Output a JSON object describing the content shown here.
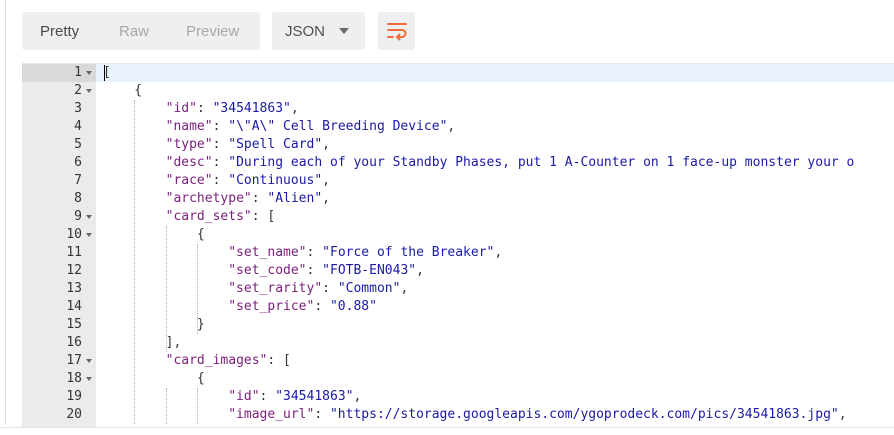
{
  "toolbar": {
    "pretty_label": "Pretty",
    "raw_label": "Raw",
    "preview_label": "Preview",
    "format_label": "JSON",
    "active_tab": "Pretty",
    "wrap_icon": "wrap-lines-icon",
    "accent_color": "#f26b3a"
  },
  "editor": {
    "lines": [
      {
        "n": "1",
        "fold": true,
        "tokens": [
          [
            "p",
            "["
          ]
        ]
      },
      {
        "n": "2",
        "fold": true,
        "tokens": [
          [
            "p",
            "    {"
          ]
        ]
      },
      {
        "n": "3",
        "fold": false,
        "tokens": [
          [
            "p",
            "        "
          ],
          [
            "k",
            "\"id\""
          ],
          [
            "p",
            ": "
          ],
          [
            "s",
            "\"34541863\""
          ],
          [
            "p",
            ","
          ]
        ]
      },
      {
        "n": "4",
        "fold": false,
        "tokens": [
          [
            "p",
            "        "
          ],
          [
            "k",
            "\"name\""
          ],
          [
            "p",
            ": "
          ],
          [
            "s",
            "\"\\\"A\\\" Cell Breeding Device\""
          ],
          [
            "p",
            ","
          ]
        ]
      },
      {
        "n": "5",
        "fold": false,
        "tokens": [
          [
            "p",
            "        "
          ],
          [
            "k",
            "\"type\""
          ],
          [
            "p",
            ": "
          ],
          [
            "s",
            "\"Spell Card\""
          ],
          [
            "p",
            ","
          ]
        ]
      },
      {
        "n": "6",
        "fold": false,
        "tokens": [
          [
            "p",
            "        "
          ],
          [
            "k",
            "\"desc\""
          ],
          [
            "p",
            ": "
          ],
          [
            "s",
            "\"During each of your Standby Phases, put 1 A-Counter on 1 face-up monster your o"
          ]
        ]
      },
      {
        "n": "7",
        "fold": false,
        "tokens": [
          [
            "p",
            "        "
          ],
          [
            "k",
            "\"race\""
          ],
          [
            "p",
            ": "
          ],
          [
            "s",
            "\"Continuous\""
          ],
          [
            "p",
            ","
          ]
        ]
      },
      {
        "n": "8",
        "fold": false,
        "tokens": [
          [
            "p",
            "        "
          ],
          [
            "k",
            "\"archetype\""
          ],
          [
            "p",
            ": "
          ],
          [
            "s",
            "\"Alien\""
          ],
          [
            "p",
            ","
          ]
        ]
      },
      {
        "n": "9",
        "fold": true,
        "tokens": [
          [
            "p",
            "        "
          ],
          [
            "k",
            "\"card_sets\""
          ],
          [
            "p",
            ": ["
          ]
        ]
      },
      {
        "n": "10",
        "fold": true,
        "tokens": [
          [
            "p",
            "            {"
          ]
        ]
      },
      {
        "n": "11",
        "fold": false,
        "tokens": [
          [
            "p",
            "                "
          ],
          [
            "k",
            "\"set_name\""
          ],
          [
            "p",
            ": "
          ],
          [
            "s",
            "\"Force of the Breaker\""
          ],
          [
            "p",
            ","
          ]
        ]
      },
      {
        "n": "12",
        "fold": false,
        "tokens": [
          [
            "p",
            "                "
          ],
          [
            "k",
            "\"set_code\""
          ],
          [
            "p",
            ": "
          ],
          [
            "s",
            "\"FOTB-EN043\""
          ],
          [
            "p",
            ","
          ]
        ]
      },
      {
        "n": "13",
        "fold": false,
        "tokens": [
          [
            "p",
            "                "
          ],
          [
            "k",
            "\"set_rarity\""
          ],
          [
            "p",
            ": "
          ],
          [
            "s",
            "\"Common\""
          ],
          [
            "p",
            ","
          ]
        ]
      },
      {
        "n": "14",
        "fold": false,
        "tokens": [
          [
            "p",
            "                "
          ],
          [
            "k",
            "\"set_price\""
          ],
          [
            "p",
            ": "
          ],
          [
            "s",
            "\"0.88\""
          ]
        ]
      },
      {
        "n": "15",
        "fold": false,
        "tokens": [
          [
            "p",
            "            }"
          ]
        ]
      },
      {
        "n": "16",
        "fold": false,
        "tokens": [
          [
            "p",
            "        ],"
          ]
        ]
      },
      {
        "n": "17",
        "fold": true,
        "tokens": [
          [
            "p",
            "        "
          ],
          [
            "k",
            "\"card_images\""
          ],
          [
            "p",
            ": ["
          ]
        ]
      },
      {
        "n": "18",
        "fold": true,
        "tokens": [
          [
            "p",
            "            {"
          ]
        ]
      },
      {
        "n": "19",
        "fold": false,
        "tokens": [
          [
            "p",
            "                "
          ],
          [
            "k",
            "\"id\""
          ],
          [
            "p",
            ": "
          ],
          [
            "s",
            "\"34541863\""
          ],
          [
            "p",
            ","
          ]
        ]
      },
      {
        "n": "20",
        "fold": false,
        "tokens": [
          [
            "p",
            "                "
          ],
          [
            "k",
            "\"image_url\""
          ],
          [
            "p",
            ": "
          ],
          [
            "s",
            "\"https://storage.googleapis.com/ygoprodeck.com/pics/34541863.jpg\""
          ],
          [
            "p",
            ","
          ]
        ]
      }
    ]
  }
}
